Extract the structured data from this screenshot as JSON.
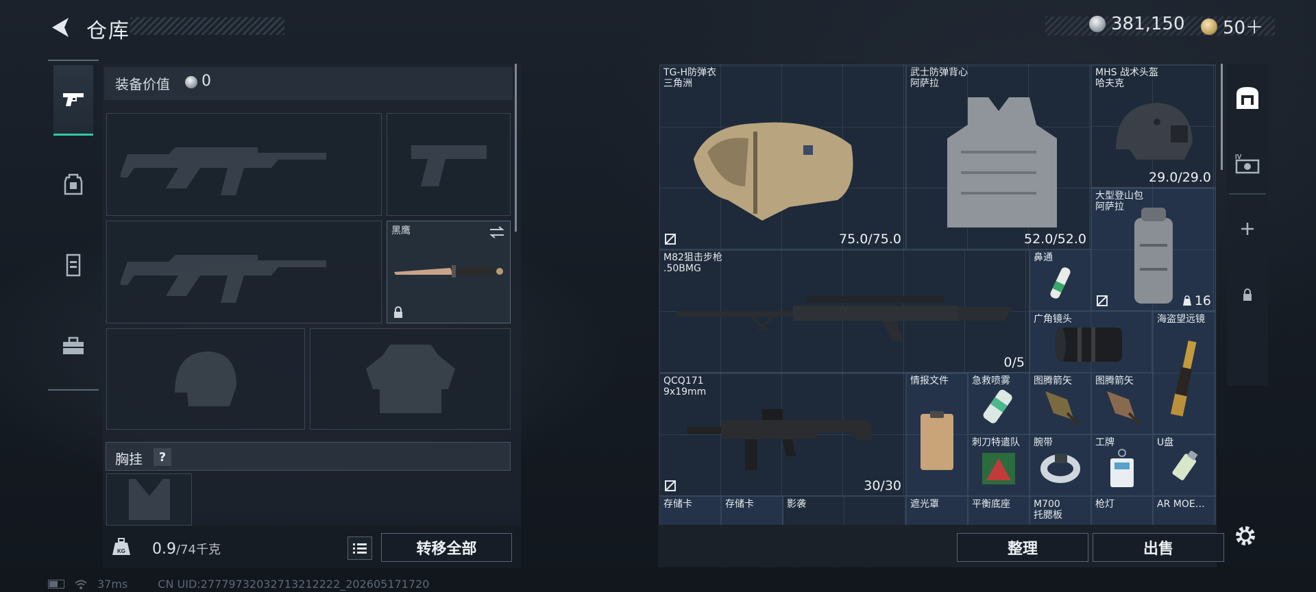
{
  "header": {
    "title": "仓库"
  },
  "currency": [
    {
      "type": "silver",
      "amount": "381,150"
    },
    {
      "type": "gold",
      "amount": "50＋"
    }
  ],
  "nav": [
    {
      "icon": "pistol-icon",
      "active": true
    },
    {
      "icon": "backpack-icon",
      "active": false
    },
    {
      "icon": "chest-rig-icon",
      "active": false
    },
    {
      "icon": "toolbox-icon",
      "active": false
    }
  ],
  "loadout": {
    "value_label": "装备价值",
    "value": "0",
    "melee_label": "黑鹰",
    "chest_rig_label": "胸挂",
    "chest_rig_help": "?"
  },
  "footer": {
    "weight": "0.9",
    "weight_cap": "/74千克",
    "transfer_all": "转移全部"
  },
  "status": {
    "ping": "37ms",
    "uid": "CN UID:27779732032713212222_202605171720"
  },
  "stash": {
    "items": [
      {
        "name": "TG-H防弹衣",
        "sub": "三角洲",
        "durability": "75.0/75.0",
        "icon": "body-armor-icon"
      },
      {
        "name": "武士防弹背心",
        "sub": "阿萨拉",
        "durability": "52.0/52.0",
        "icon": "vest-icon"
      },
      {
        "name": "MHS 战术头盔",
        "sub": "哈夫克",
        "durability": "29.0/29.0",
        "icon": "helmet-icon"
      },
      {
        "name": "大型登山包",
        "sub": "阿萨拉",
        "count": "16",
        "icon": "backpack-icon"
      },
      {
        "name": "M82狙击步枪",
        "sub": ".50BMG",
        "ammo": "0/5",
        "icon": "sniper-rifle-icon"
      },
      {
        "name": "鼻通",
        "icon": "nasal-inhaler-icon"
      },
      {
        "name": "广角镜头",
        "icon": "camera-lens-icon"
      },
      {
        "name": "海盗望远镜",
        "icon": "spyglass-icon"
      },
      {
        "name": "QCQ171",
        "sub": "9x19mm",
        "ammo": "30/30",
        "icon": "smg-icon"
      },
      {
        "name": "情报文件",
        "icon": "clipboard-icon"
      },
      {
        "name": "急救喷雾",
        "icon": "spray-icon"
      },
      {
        "name": "图腾箭矢",
        "icon": "arrowhead-icon"
      },
      {
        "name": "图腾箭矢",
        "icon": "arrowhead-icon"
      },
      {
        "name": "刺刀特遣队",
        "icon": "game-box-icon"
      },
      {
        "name": "腕带",
        "icon": "wristband-icon"
      },
      {
        "name": "工牌",
        "icon": "badge-icon"
      },
      {
        "name": "U盘",
        "icon": "usb-drive-icon"
      },
      {
        "name": "存储卡",
        "icon": "memory-card-icon"
      },
      {
        "name": "存储卡",
        "icon": "memory-card-icon"
      },
      {
        "name": "影袭",
        "icon": "weapon-icon"
      },
      {
        "name": "遮光罩",
        "icon": "lens-hood-icon"
      },
      {
        "name": "平衡底座",
        "icon": "base-icon"
      },
      {
        "name": "M700",
        "sub": "托腮板",
        "icon": "cheek-rest-icon"
      },
      {
        "name": "枪灯",
        "icon": "flashlight-icon"
      },
      {
        "name": "AR MOE…",
        "icon": "grip-icon"
      }
    ],
    "sort": "整理",
    "sell": "出售"
  },
  "side_tabs": [
    {
      "icon": "stash-icon",
      "label": ""
    },
    {
      "icon": "level-gallery-icon",
      "label": ""
    },
    {
      "icon": "plus-icon",
      "label": ""
    },
    {
      "icon": "lock-icon",
      "label": ""
    }
  ],
  "colors": {
    "accent": "#2fc8a3",
    "item_bg": "#1e2a39",
    "item_bg_blue": "#243349"
  }
}
